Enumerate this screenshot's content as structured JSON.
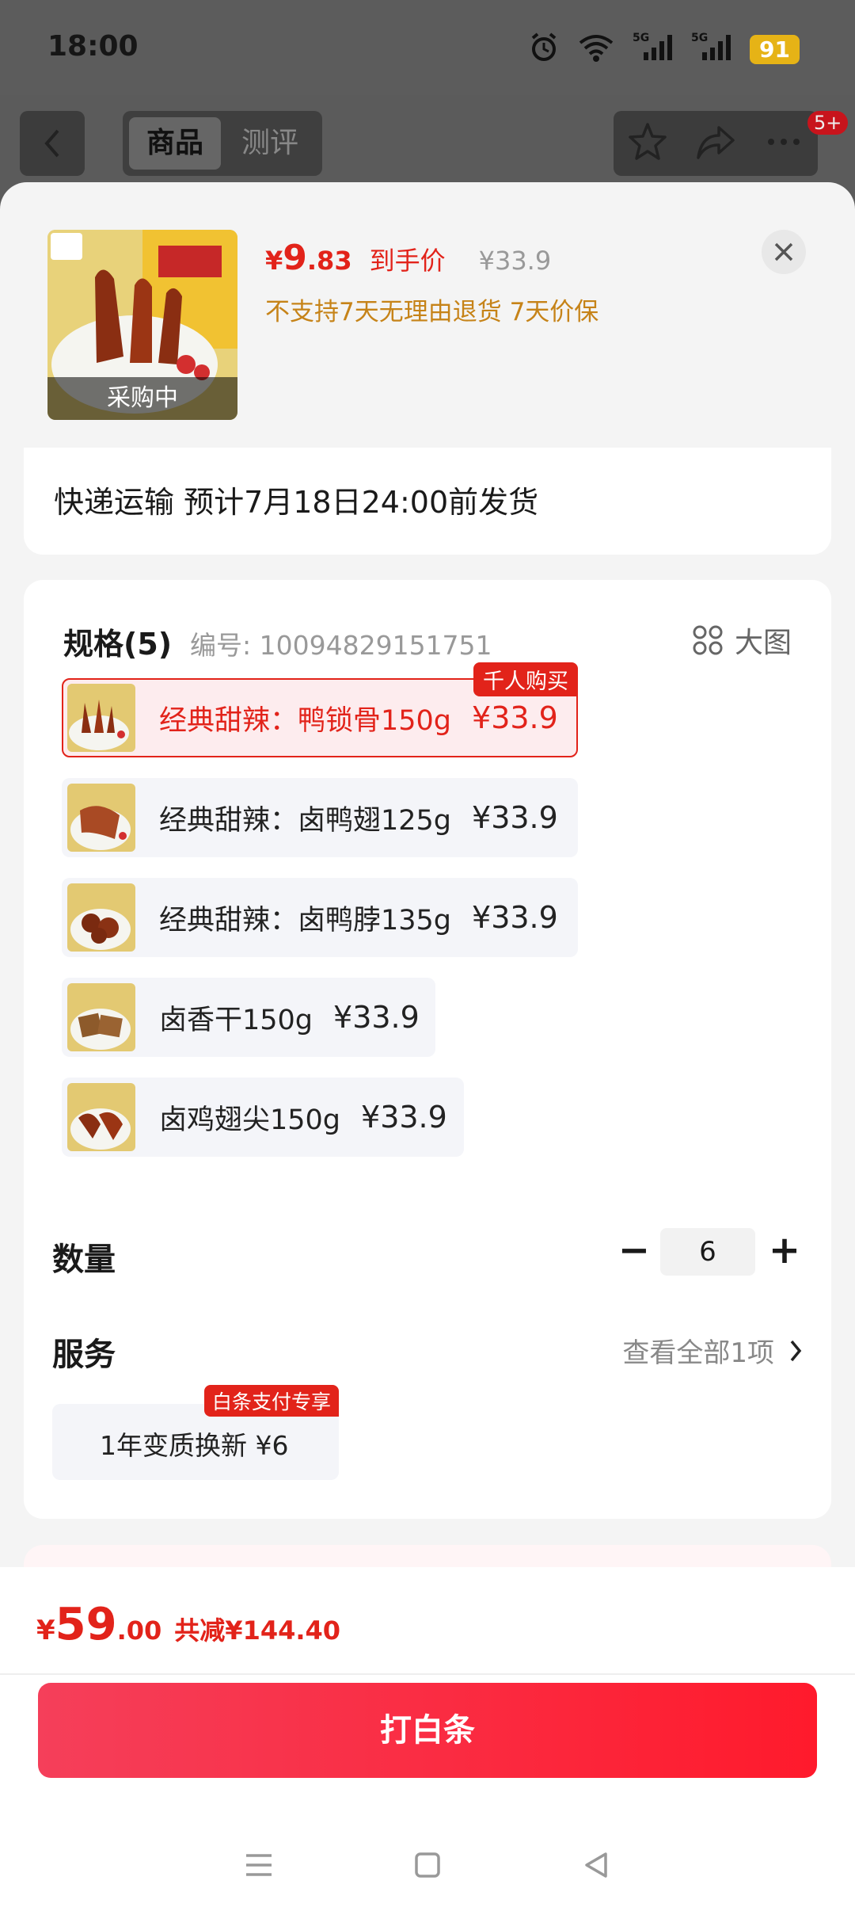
{
  "status_bar": {
    "time": "18:00",
    "battery": "91",
    "icons": [
      "alarm-icon",
      "wifi-icon",
      "signal-5g-icon",
      "signal-5g-icon"
    ]
  },
  "nav": {
    "tabs": [
      {
        "label": "商品",
        "active": true
      },
      {
        "label": "测评",
        "active": false
      }
    ],
    "message_badge": "5+"
  },
  "product": {
    "image_label": "采购中",
    "price_symbol": "¥",
    "price_int": "9",
    "price_dec": ".83",
    "price_label": "到手价",
    "original_price": "¥33.9",
    "policy": "不支持7天无理由退货  7天价保"
  },
  "shipping": {
    "text": "快递运输 预计7月18日24:00前发货"
  },
  "spec": {
    "title": "规格(5)",
    "code": "编号: 10094829151751",
    "bigpic_label": "大图",
    "variants": [
      {
        "name": "经典甜辣：鸭锁骨150g",
        "price": "¥33.9",
        "selected": true,
        "tag": "千人购买"
      },
      {
        "name": "经典甜辣：卤鸭翅125g",
        "price": "¥33.9",
        "selected": false,
        "tag": ""
      },
      {
        "name": "经典甜辣：卤鸭脖135g",
        "price": "¥33.9",
        "selected": false,
        "tag": ""
      },
      {
        "name": "卤香干150g",
        "price": "¥33.9",
        "selected": false,
        "tag": ""
      },
      {
        "name": "卤鸡翅尖150g",
        "price": "¥33.9",
        "selected": false,
        "tag": ""
      }
    ]
  },
  "quantity": {
    "label": "数量",
    "minus": "−",
    "value": "6",
    "plus": "+"
  },
  "service": {
    "label": "服务",
    "view_all": "查看全部1项",
    "item_text": "1年变质换新  ¥6",
    "item_tag": "白条支付专享"
  },
  "footer": {
    "total_symbol": "¥",
    "total_int": "59",
    "total_dec": ".00",
    "savings": "共减¥144.40",
    "pay_button": "打白条"
  },
  "colors": {
    "accent": "#e2231a",
    "policy": "#c68318",
    "button_start": "#f53f5a",
    "button_end": "#ff1a2c"
  }
}
